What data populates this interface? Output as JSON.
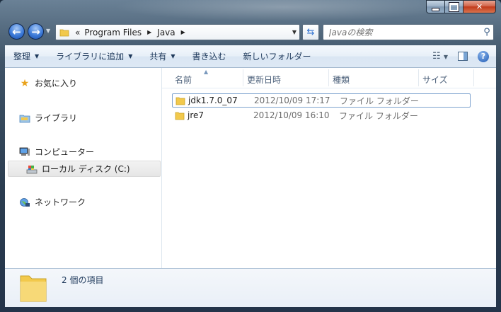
{
  "address": {
    "overflow": "«",
    "crumbs": [
      "Program Files",
      "Java"
    ]
  },
  "search": {
    "placeholder": "Javaの検索"
  },
  "toolbar": {
    "organize": "整理",
    "add_to_library": "ライブラリに追加",
    "share": "共有",
    "burn": "書き込む",
    "new_folder": "新しいフォルダー"
  },
  "nav_pane": {
    "favorites": "お気に入り",
    "libraries": "ライブラリ",
    "computer": "コンピューター",
    "local_disk": "ローカル ディスク (C:)",
    "network": "ネットワーク"
  },
  "columns": {
    "name": "名前",
    "modified": "更新日時",
    "type": "種類",
    "size": "サイズ"
  },
  "files": [
    {
      "name": "jdk1.7.0_07",
      "modified": "2012/10/09 17:17",
      "type": "ファイル フォルダー"
    },
    {
      "name": "jre7",
      "modified": "2012/10/09 16:10",
      "type": "ファイル フォルダー"
    }
  ],
  "details": {
    "count_text": "2 個の項目"
  },
  "colors": {
    "accent": "#1f5bb5",
    "folder": "#f2c94c",
    "selection_border": "#7da2ce"
  }
}
